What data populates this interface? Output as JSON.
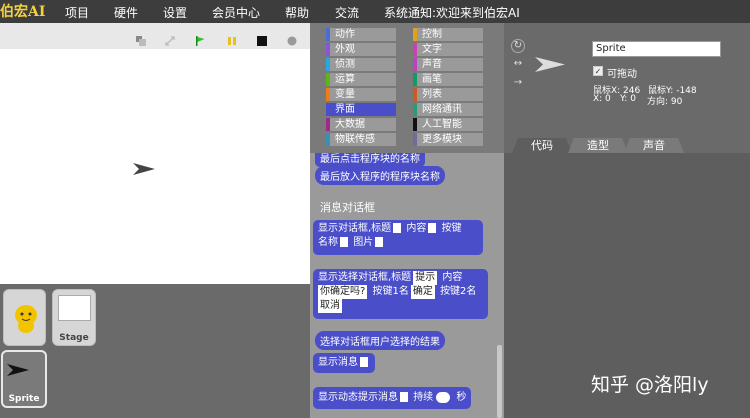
{
  "menu": {
    "logo": "伯宏AI",
    "items": [
      "项目",
      "硬件",
      "设置",
      "会员中心",
      "帮助",
      "交流"
    ],
    "notice": "系统通知:欢迎来到伯宏AI"
  },
  "stage_toolbar": {
    "icons": [
      "restore-icon",
      "fullscreen-icon",
      "green-flag-icon",
      "pause-icon",
      "stop-icon",
      "record-icon"
    ]
  },
  "sprites": {
    "items": [
      {
        "label": "",
        "selected": false,
        "icon": "cartoon-character-icon"
      },
      {
        "label": "Stage",
        "selected": false,
        "icon": "stage-thumbnail"
      },
      {
        "label": "Sprite",
        "selected": true,
        "icon": "arrow-sprite-icon"
      }
    ]
  },
  "categories": {
    "items": [
      {
        "label": "动作",
        "color": "#4a6cd4"
      },
      {
        "label": "控制",
        "color": "#e0a020"
      },
      {
        "label": "外观",
        "color": "#8a55d7"
      },
      {
        "label": "文字",
        "color": "#d03fb0"
      },
      {
        "label": "侦测",
        "color": "#2ca5e2"
      },
      {
        "label": "声音",
        "color": "#bb42c3"
      },
      {
        "label": "运算",
        "color": "#5cb712"
      },
      {
        "label": "画笔",
        "color": "#0e9a6c"
      },
      {
        "label": "变量",
        "color": "#ee7d16"
      },
      {
        "label": "列表",
        "color": "#cc5b22"
      },
      {
        "label": "界面",
        "color": "#4a4ec9"
      },
      {
        "label": "网络通讯",
        "color": "#2a9d70"
      },
      {
        "label": "大数据",
        "color": "#9b2c8c"
      },
      {
        "label": "人工智能",
        "color": "#111111"
      },
      {
        "label": "物联传感",
        "color": "#3a8fb7"
      },
      {
        "label": "更多模块",
        "color": "#6d6d9d"
      }
    ],
    "selected": "界面"
  },
  "palette": {
    "b0": "最后点击程序块的名称",
    "b1": "最后放入程序的程序块名称",
    "section": "消息对话框",
    "b2": {
      "l1": "显示对话框,标题",
      "t1": "内容",
      "t2": "按键",
      "l2": "名称",
      "t3": "图片"
    },
    "b3": {
      "l1": "显示选择对话框,标题",
      "c1": "提示",
      "t1": "内容",
      "c2": "你确定吗?",
      "t2": "按键1名",
      "c3": "确定",
      "t3": "按键2名",
      "c4": "取消"
    },
    "b4": "选择对话框用户选择的结果",
    "b5": "显示消息",
    "b6": {
      "l1": "显示动态提示消息",
      "t1": "持续",
      "t2": "秒"
    }
  },
  "sprite_info": {
    "name": "Sprite",
    "draggable_label": "可拖动",
    "mouse_x": "鼠标X: 246",
    "mouse_y": "鼠标Y: -148",
    "x": "X: 0",
    "y": "Y: 0",
    "direction": "方向: 90",
    "rotate_icons": [
      "rotate-icon",
      "flip-horizontal-icon",
      "no-rotate-icon"
    ]
  },
  "tabs": [
    {
      "label": "代码",
      "selected": true
    },
    {
      "label": "造型",
      "selected": false
    },
    {
      "label": "声音",
      "selected": false
    }
  ],
  "watermark": "知乎 @洛阳ly",
  "colors": {
    "accent": "#4a4ec9",
    "logo": "#f5d23c",
    "bg": "#5e5e5e"
  }
}
